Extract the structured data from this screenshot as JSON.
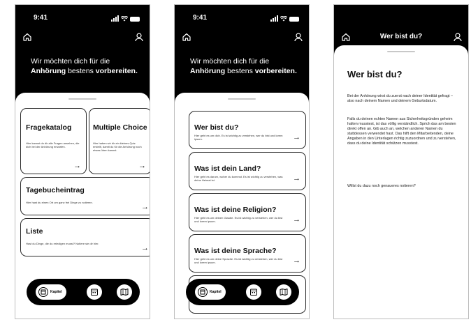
{
  "status": {
    "time": "9:41"
  },
  "screen1": {
    "hero_line1": "Wir möchten dich für die",
    "hero_bold1": "Anhörung",
    "hero_mid": " bestens ",
    "hero_bold2": "vorbereiten.",
    "cards": [
      {
        "title": "Fragekatalog",
        "desc": "Hier kannst du dir alle Fragen ansehen, die dich bei der Anhörung erwarten."
      },
      {
        "title": "Multiple Choice",
        "desc": "Hier haben wir dir ein kleines Quiz erstellt, damit du für die Anhörung noch etwas üben kannst."
      },
      {
        "title": "Tagebucheintrag",
        "desc": "Hier hast du einen Ort um ganz frei Dinge zu notieren."
      },
      {
        "title": "Liste",
        "desc": "Hast du Dinge, die du erledigen musst? Notiere sie dir hier."
      }
    ],
    "nav_label": "Kapitel"
  },
  "screen2": {
    "hero_line1": "Wir möchten dich für die",
    "hero_bold1": "Anhörung",
    "hero_mid": " bestens ",
    "hero_bold2": "vorbereiten.",
    "cards": [
      {
        "title": "Wer bist du?",
        "desc": "Hier geht es um dich. Es ist wichtig zu verstehen, wer du bist und lorem ipsum."
      },
      {
        "title": "Was ist dein Land?",
        "desc": "Hier geht es darum, woher du kommst. Es ist wichtig zu verstehen, was deine Heimat ist."
      },
      {
        "title": "Was ist deine Religion?",
        "desc": "Hier geht es um deinen Glaube. Es ist wichtig zu verstehen, wer du bist und lorem ipsum."
      },
      {
        "title": "Was ist deine Sprache?",
        "desc": "Hier geht es um deine Sprache. Es ist wichtig zu verstehen, wer du bist und lorem ipsum."
      }
    ],
    "nav_label": "Kapitel"
  },
  "screen3": {
    "topbar_title": "Wer bist du?",
    "title": "Wer bist du?",
    "paragraphs": [
      "Bei der Anhörung wirst du zuerst nach deiner Identität gefragt – also nach deinem Namen und deinem Geburtsdatum.",
      "Falls du deinen echten Namen aus Sicherheitsgründen geheim halten musstest, ist das völlig verständlich. Sprich das am besten direkt offen an. Gib auch an, welchen anderen Namen du stattdessen verwendet hast. Das hilft den Mitarbeitenden, deine Angaben in den Unterlagen richtig zuzuordnen und zu verstehen, dass du deine Identität schützen musstest.",
      "Willst du dazu noch genaueres notieren?"
    ]
  },
  "icons": {
    "home": "home-icon",
    "user": "user-icon",
    "arrow": "arrow-right-icon",
    "book": "book-icon",
    "calendar": "calendar-icon",
    "map": "map-icon"
  },
  "arrow_glyph": "→"
}
